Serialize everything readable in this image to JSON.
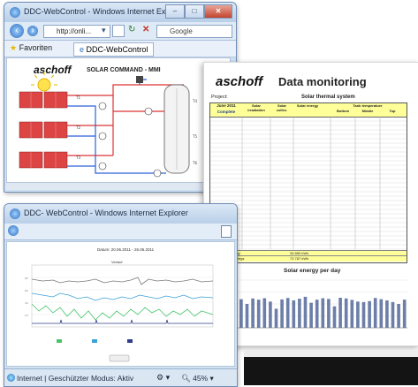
{
  "window1": {
    "title": "DDC-WebControl - Windows Internet Explorer",
    "address": "http://onli...",
    "search_placeholder": "Google",
    "favorites": "Favoriten",
    "tab": "DDC-WebControl",
    "logo": "aschoff",
    "diagram_title": "SOLAR COMMAND - MMI"
  },
  "sheet": {
    "logo": "aschoff",
    "title": "Data monitoring",
    "project_label": "Project:",
    "project_value": "Solar thermal system",
    "header": {
      "period": "June 2011",
      "period2": "Complete",
      "col_solar_irr": "Solar irradiation",
      "col_solar_coll": "Solar collec.",
      "col_solar_energy": "Solar energy",
      "col_tank": "Tank temperature",
      "col_bottom": "Bottom",
      "col_middle": "Middle",
      "col_top": "Top"
    },
    "total_label": "Total solar energy",
    "total_savings_label": "Total energy savings",
    "total_value": "26 850 kWh",
    "total_savings_value": "73 787 kWh",
    "chart_title": "Solar energy per day"
  },
  "window2": {
    "title": "DDC- WebControl - Windows Internet Explorer",
    "chart_heading": "Datum: 20.06.2011 - 26.06.2011",
    "chart_panel_label": "Verlauf",
    "status": "Internet | Geschützter Modus: Aktiv",
    "zoom": "45%"
  },
  "chart_data": {
    "type": "bar",
    "title": "Solar energy per day",
    "values": [
      1150,
      1200,
      1000,
      1230,
      1180,
      1240,
      1100,
      800,
      1190,
      1250,
      1150,
      1220,
      1300,
      1050,
      1180,
      1240,
      1210,
      900,
      1260,
      1230,
      1170,
      1100,
      1080,
      1120,
      1250,
      1200,
      1150,
      1080,
      1000,
      1180
    ],
    "ylim": [
      0,
      2000
    ]
  },
  "colors": {
    "sheet_header": "#ffff99",
    "bars": "#6d7fa8",
    "ie_frame": "#cfe0f1",
    "close_button": "#c4432e"
  }
}
